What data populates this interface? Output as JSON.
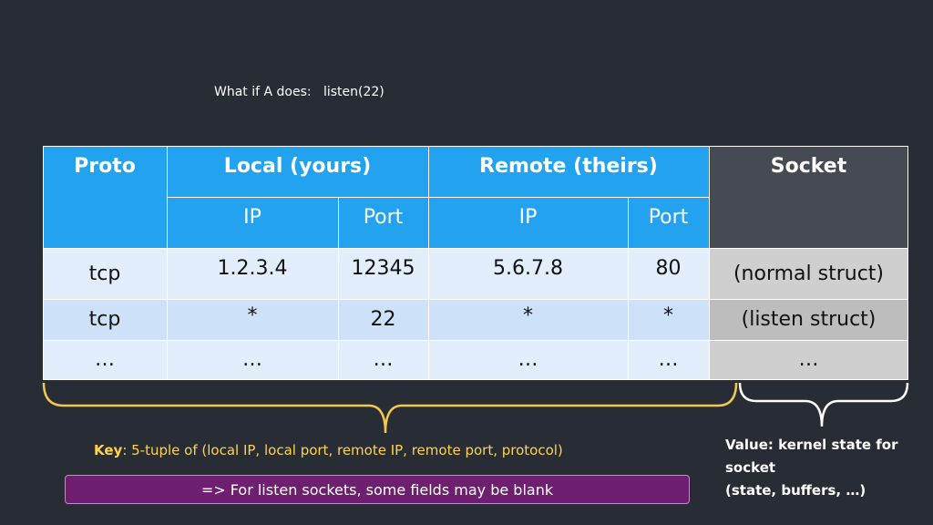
{
  "caption": {
    "prefix": "What if A does:",
    "call": "listen(22)"
  },
  "table": {
    "headers": {
      "proto": "Proto",
      "local": "Local (yours)",
      "remote": "Remote (theirs)",
      "socket": "Socket"
    },
    "subheaders": {
      "local_ip": "IP",
      "local_port": "Port",
      "remote_ip": "IP",
      "remote_port": "Port"
    },
    "rows": [
      {
        "proto": "tcp",
        "local_ip": "1.2.3.4",
        "local_port": "12345",
        "remote_ip": "5.6.7.8",
        "remote_port": "80",
        "socket": "(normal struct)"
      },
      {
        "proto": "tcp",
        "local_ip": "*",
        "local_port": "22",
        "remote_ip": "*",
        "remote_port": "*",
        "socket": "(listen struct)"
      },
      {
        "proto": "…",
        "local_ip": "…",
        "local_port": "…",
        "remote_ip": "…",
        "remote_port": "…",
        "socket": "…"
      }
    ]
  },
  "key": {
    "label": "Key",
    "text": "5-tuple of (local IP, local port, remote IP, remote port, protocol)"
  },
  "value": {
    "line1": "Value: kernel state for",
    "line2": "socket",
    "line3": "(state, buffers, …)"
  },
  "note": {
    "text": "=> For listen sockets, some fields may be blank"
  },
  "colors": {
    "header_blue": "#22a2ef",
    "socket_header": "#464a52",
    "key_yellow": "#ffd34d",
    "note_purple": "#6e1f6f"
  }
}
